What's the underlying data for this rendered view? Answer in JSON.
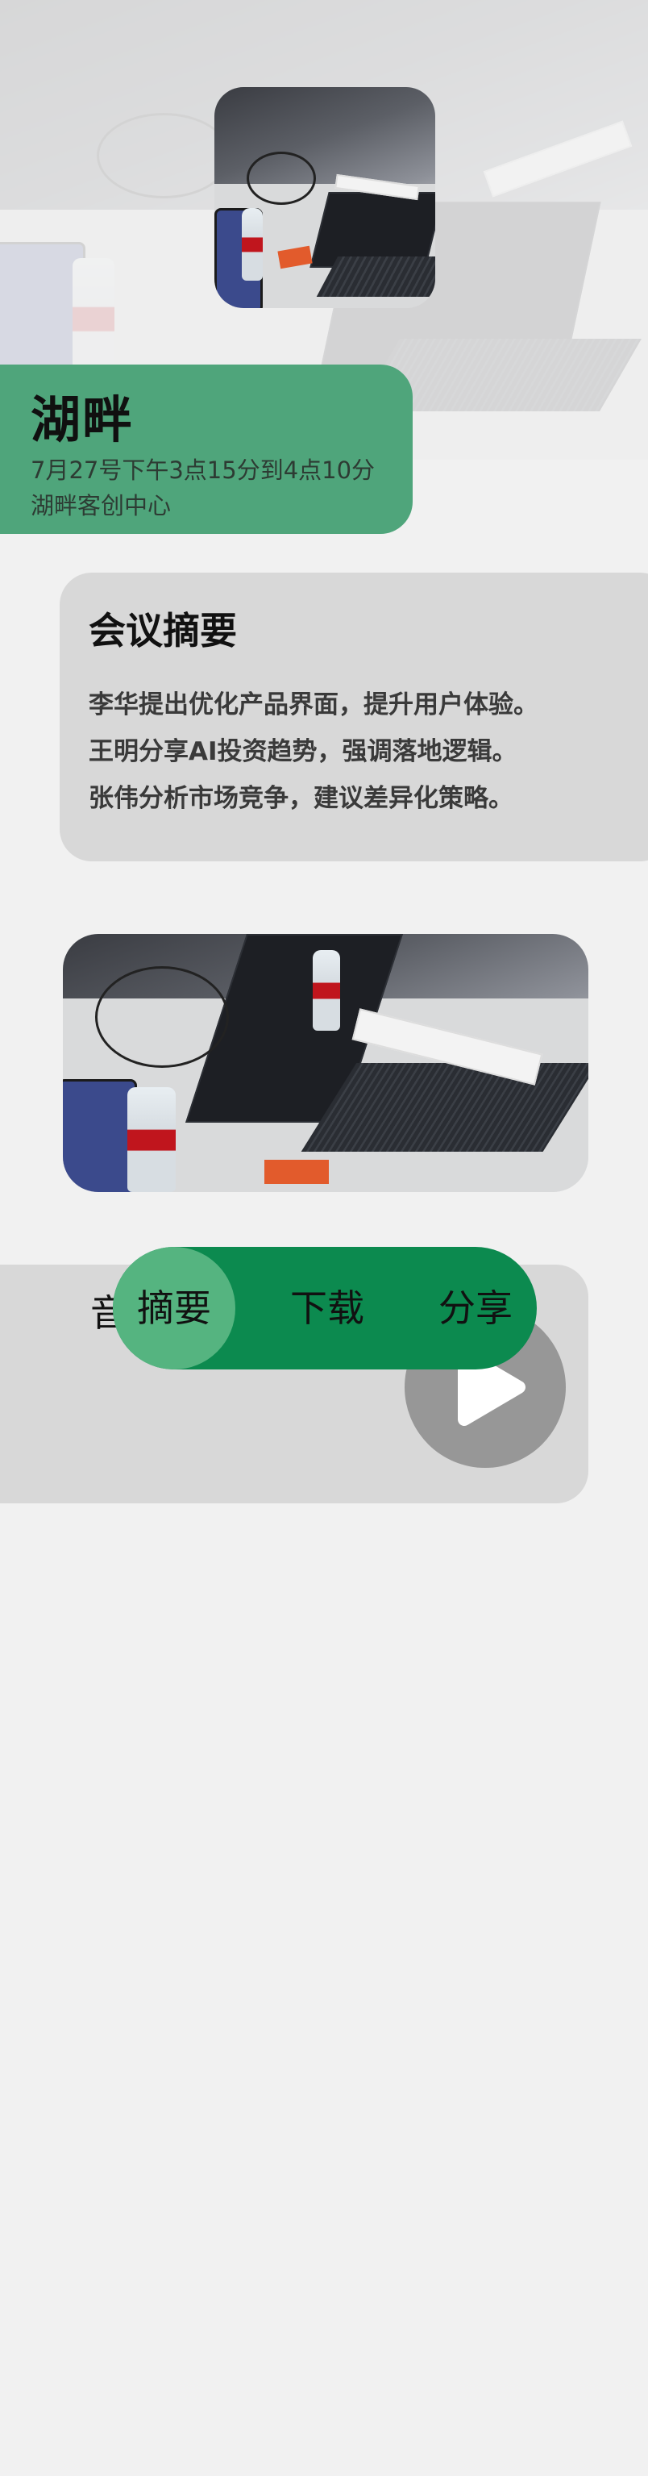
{
  "meeting": {
    "title": "湖畔",
    "time": "7月27号下午3点15分到4点10分",
    "location": "湖畔客创中心"
  },
  "summary": {
    "heading": "会议摘要",
    "lines": [
      "李华提出优化产品界面，提升用户体验。",
      "王明分享AI投资趋势，强调落地逻辑。",
      "张伟分析市场竞争，建议差异化策略。"
    ]
  },
  "audio": {
    "label": "音",
    "play_icon": "play-icon"
  },
  "tabs": {
    "selected": "摘要",
    "items": [
      "摘要",
      "下载",
      "分享"
    ]
  },
  "colors": {
    "title_card": "#4fa57b",
    "tab_bar": "#0c8a4f",
    "tab_selected": "#55b480",
    "card_gray": "#d8d8d8",
    "play_button": "#979797"
  }
}
